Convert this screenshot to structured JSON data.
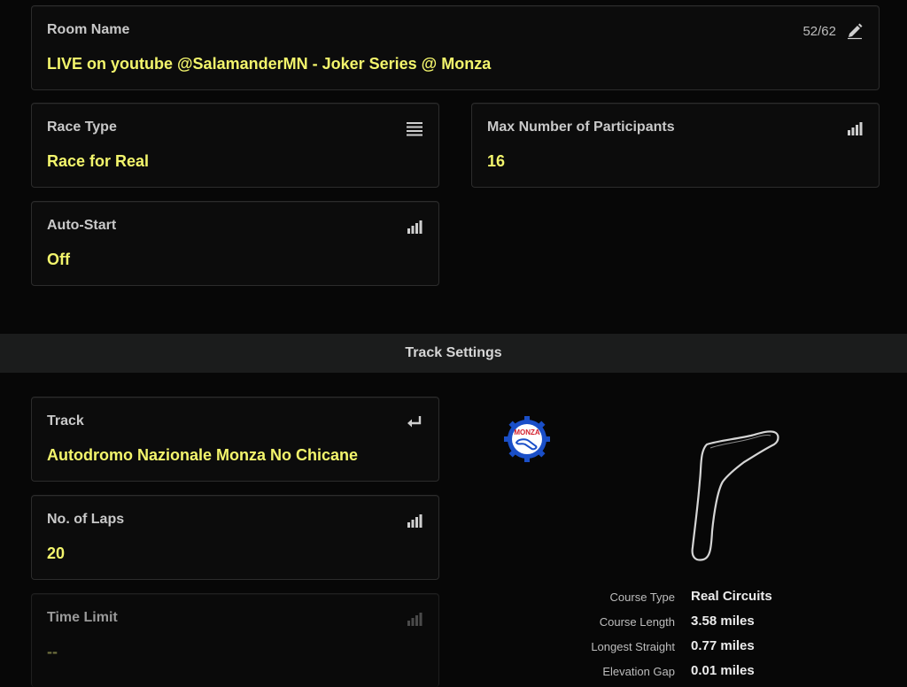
{
  "room": {
    "label": "Room Name",
    "value": "LIVE on youtube @SalamanderMN - Joker Series @ Monza",
    "counter": "52/62",
    "icon": "pencil-icon"
  },
  "race_type": {
    "label": "Race Type",
    "value": "Race for Real",
    "icon": "list-icon"
  },
  "max_participants": {
    "label": "Max Number of Participants",
    "value": "16",
    "icon": "signal-bars-icon"
  },
  "auto_start": {
    "label": "Auto-Start",
    "value": "Off",
    "icon": "signal-bars-icon"
  },
  "section": {
    "title": "Track Settings"
  },
  "track": {
    "label": "Track",
    "value": "Autodromo Nazionale Monza No Chicane",
    "icon": "enter-arrow-icon"
  },
  "laps": {
    "label": "No. of Laps",
    "value": "20",
    "icon": "signal-bars-icon"
  },
  "time_limit": {
    "label": "Time Limit",
    "value": "--",
    "icon": "signal-bars-icon"
  },
  "track_logo": {
    "text": "MONZA",
    "icon": "monza-logo-icon"
  },
  "course": {
    "type_label": "Course Type",
    "type_value": "Real Circuits",
    "length_label": "Course Length",
    "length_value": "3.58 miles",
    "straight_label": "Longest Straight",
    "straight_value": "0.77 miles",
    "elevation_label": "Elevation Gap",
    "elevation_value": "0.01 miles"
  },
  "colors": {
    "accent": "#f3f56c",
    "background": "#070707",
    "section_bar": "#1b1c1c"
  }
}
